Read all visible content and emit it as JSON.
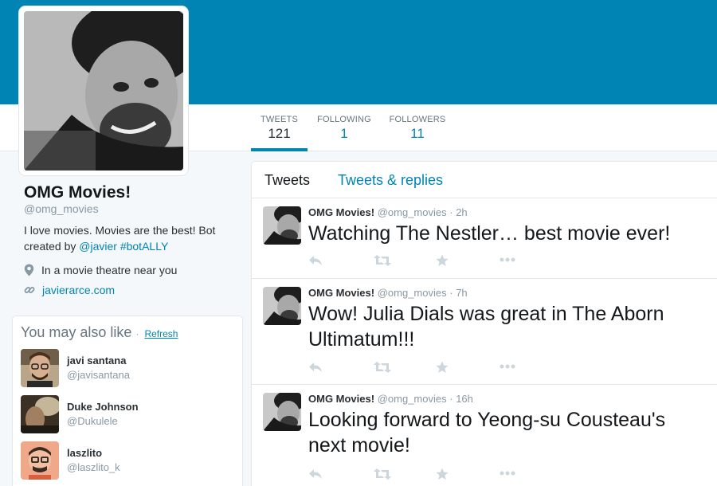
{
  "profile": {
    "name": "OMG Movies!",
    "handle": "@omg_movies",
    "bio_text": "I love movies. Movies are the best! Bot created by",
    "bio_mention": "@javier",
    "bio_hashtag": "#botALLY",
    "location": "In a movie theatre near you",
    "website": "javierarce.com"
  },
  "stats": [
    {
      "label": "TWEETS",
      "value": "121"
    },
    {
      "label": "FOLLOWING",
      "value": "1"
    },
    {
      "label": "FOLLOWERS",
      "value": "11"
    }
  ],
  "who_to_follow": {
    "title": "You may also like",
    "refresh": "Refresh",
    "suggestions": [
      {
        "name": "javi santana",
        "handle": "@javisantana"
      },
      {
        "name": "Duke Johnson",
        "handle": "@Dukulele"
      },
      {
        "name": "laszlito",
        "handle": "@laszlito_k"
      }
    ]
  },
  "timeline": {
    "tabs": [
      "Tweets",
      "Tweets & replies"
    ],
    "tweets": [
      {
        "name": "OMG Movies!",
        "handle": "@omg_movies",
        "separator": "·",
        "time": "2h",
        "text": "Watching The Nestler… best movie ever!"
      },
      {
        "name": "OMG Movies!",
        "handle": "@omg_movies",
        "separator": "·",
        "time": "7h",
        "text": "Wow! Julia Dials was great in The Aborn Ultimatum!!!"
      },
      {
        "name": "OMG Movies!",
        "handle": "@omg_movies",
        "separator": "·",
        "time": "16h",
        "text": "Looking forward to Yeong-su Cousteau's next movie!"
      }
    ]
  },
  "colors": {
    "brand": "#0084b4",
    "text": "#292f33",
    "muted": "#8899a6",
    "icon": "#ccd6dd"
  }
}
